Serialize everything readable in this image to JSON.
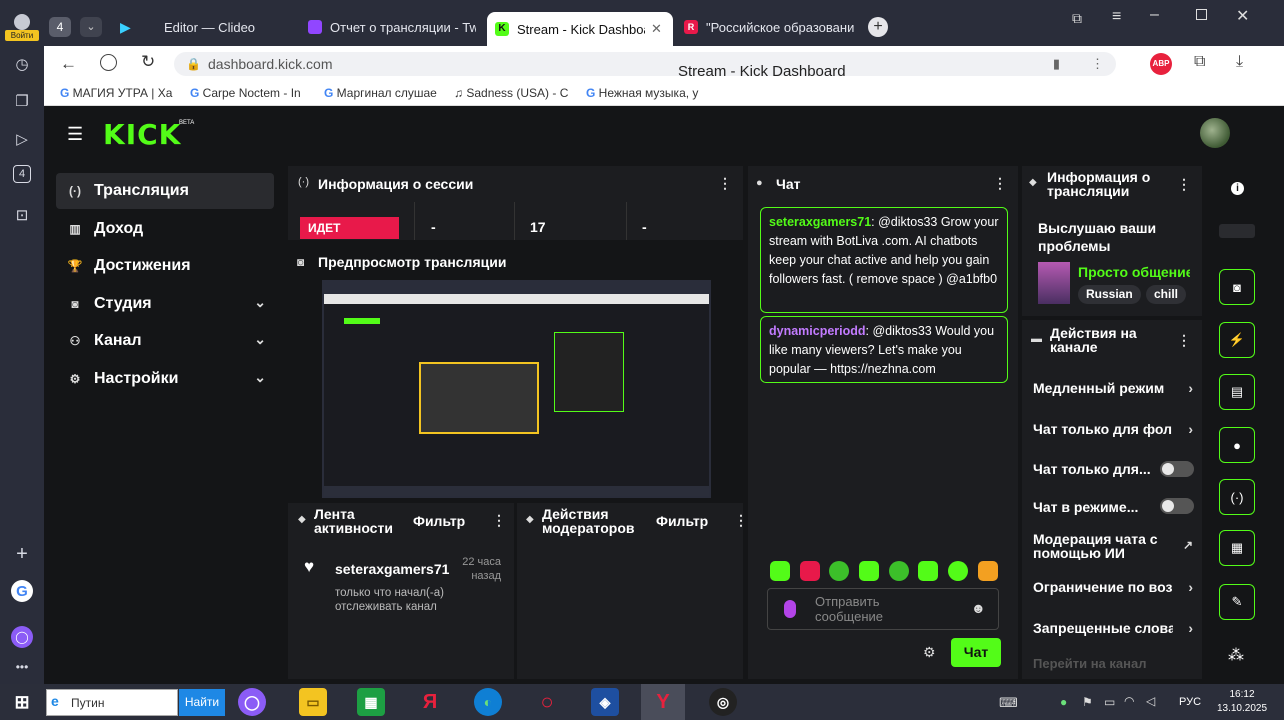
{
  "browser": {
    "login_label": "Войти",
    "tab_count": "4",
    "tabs": [
      {
        "label": "Editor — Clideo",
        "color": "#3ad0ff"
      },
      {
        "label": "Отчет о трансляции - Tw",
        "color": "#9146ff"
      },
      {
        "label": "Stream - Kick Dashboar",
        "color": "#53fc18"
      },
      {
        "label": "\"Российское образовани",
        "color": "#e8194a"
      }
    ],
    "url": "dashboard.kick.com",
    "page_title": "Stream - Kick Dashboard",
    "bookmarks": [
      "МАГИЯ УТРА | Ха",
      "Carpe Noctem - In",
      "Маргинал слушае",
      "Sadness (USA) - C",
      "Нежная музыка, у"
    ],
    "abp_label": "ABP"
  },
  "kick": {
    "logo": "KICK",
    "logo_beta": "BETA",
    "sidebar": [
      {
        "label": "Трансляция",
        "icon": "broadcast-icon",
        "glyph": "(·)",
        "active": true
      },
      {
        "label": "Доход",
        "icon": "income-icon",
        "glyph": "▥"
      },
      {
        "label": "Достижения",
        "icon": "trophy-icon",
        "glyph": "🏆"
      },
      {
        "label": "Студия",
        "icon": "studio-icon",
        "glyph": "◙",
        "chevron": true
      },
      {
        "label": "Канал",
        "icon": "channel-icon",
        "glyph": "⚇",
        "chevron": true
      },
      {
        "label": "Настройки",
        "icon": "settings-icon",
        "glyph": "⚙",
        "chevron": true
      }
    ],
    "session": {
      "title": "Информация о сессии",
      "status": "ИДЕТ",
      "stats": [
        "-",
        "17",
        "-"
      ]
    },
    "preview": {
      "title": "Предпросмотр трансляции"
    },
    "activity": {
      "title_line1": "Лента",
      "title_line2": "активности",
      "filter": "Фильтр",
      "item_user": "seteraxgamers71",
      "item_time_line1": "22 часа",
      "item_time_line2": "назад",
      "item_text_line1": "только что начал(-а)",
      "item_text_line2": "отслеживать канал"
    },
    "mod_actions": {
      "title_line1": "Действия",
      "title_line2": "модераторов",
      "filter": "Фильтр"
    },
    "chat": {
      "title": "Чат",
      "messages": [
        {
          "user": "seteraxgamers71",
          "text": ": @diktos33 Grow your stream with BotLiva .com. AI chatbots keep your chat active and help you gain followers fast. ( remove space ) @a1bfb0"
        },
        {
          "user": "dynamicperiodd",
          "text": ": @diktos33 Would you like many viewers? Let's make you popular — https://nezhna.com"
        }
      ],
      "placeholder_line1": "Отправить",
      "placeholder_line2": "сообщение",
      "send_label": "Чат"
    },
    "stream_info": {
      "title_line1": "Информация о",
      "title_line2": "трансляции",
      "stream_title_line1": "Выслушаю ваши",
      "stream_title_line2": "проблемы",
      "category": "Просто общение",
      "tags": [
        "Russian",
        "chill"
      ]
    },
    "channel_actions": {
      "title_line1": "Действия на",
      "title_line2": "канале",
      "items": [
        {
          "label": "Медленный режим",
          "kind": "chevron"
        },
        {
          "label": "Чат только для фол",
          "kind": "chevron"
        },
        {
          "label": "Чат только для...",
          "kind": "toggle"
        },
        {
          "label": "Чат в режиме...",
          "kind": "toggle"
        },
        {
          "label_line1": "Модерация чата с",
          "label_line2": "помощью ИИ",
          "kind": "external"
        },
        {
          "label": "Ограничение по воз",
          "kind": "chevron"
        },
        {
          "label": "Запрещенные слова",
          "kind": "chevron"
        }
      ],
      "footer": "Перейти на канал"
    }
  },
  "taskbar": {
    "search_placeholder": "Путин",
    "search_button": "Найти",
    "lang": "РУС",
    "time": "16:12",
    "date": "13.10.2025"
  },
  "colors": {
    "accent": "#53fc18",
    "live": "#e8194a",
    "bg": "#141517",
    "panel": "#1c1d20"
  }
}
